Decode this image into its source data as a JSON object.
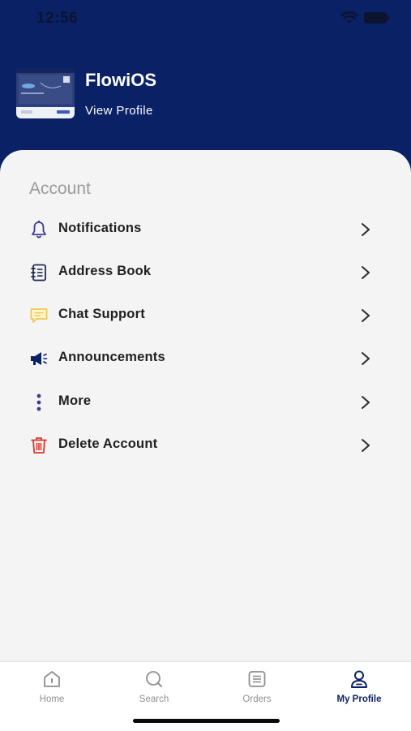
{
  "status_bar": {
    "time": "12:56"
  },
  "profile": {
    "app_name": "FlowiOS",
    "view_profile": "View Profile"
  },
  "account": {
    "title": "Account",
    "items": [
      {
        "label": "Notifications",
        "icon": "bell-icon",
        "color": "#3d3a8f"
      },
      {
        "label": "Address Book",
        "icon": "address-book-icon",
        "color": "#1f2a5a"
      },
      {
        "label": "Chat Support",
        "icon": "chat-bubble-icon",
        "color": "#f2c94c"
      },
      {
        "label": "Announcements",
        "icon": "megaphone-icon",
        "color": "#0a2166"
      },
      {
        "label": "More",
        "icon": "more-vertical-icon",
        "color": "#3d3a8f"
      },
      {
        "label": "Delete Account",
        "icon": "trash-icon",
        "color": "#e0362c"
      }
    ]
  },
  "tabs": [
    {
      "label": "Home",
      "icon": "home-icon",
      "active": false
    },
    {
      "label": "Search",
      "icon": "search-icon",
      "active": false
    },
    {
      "label": "Orders",
      "icon": "orders-list-icon",
      "active": false
    },
    {
      "label": "My Profile",
      "icon": "profile-icon",
      "active": true
    }
  ],
  "colors": {
    "header": "#0a2166",
    "card": "#f4f4f4",
    "active_tab": "#0a2166"
  }
}
